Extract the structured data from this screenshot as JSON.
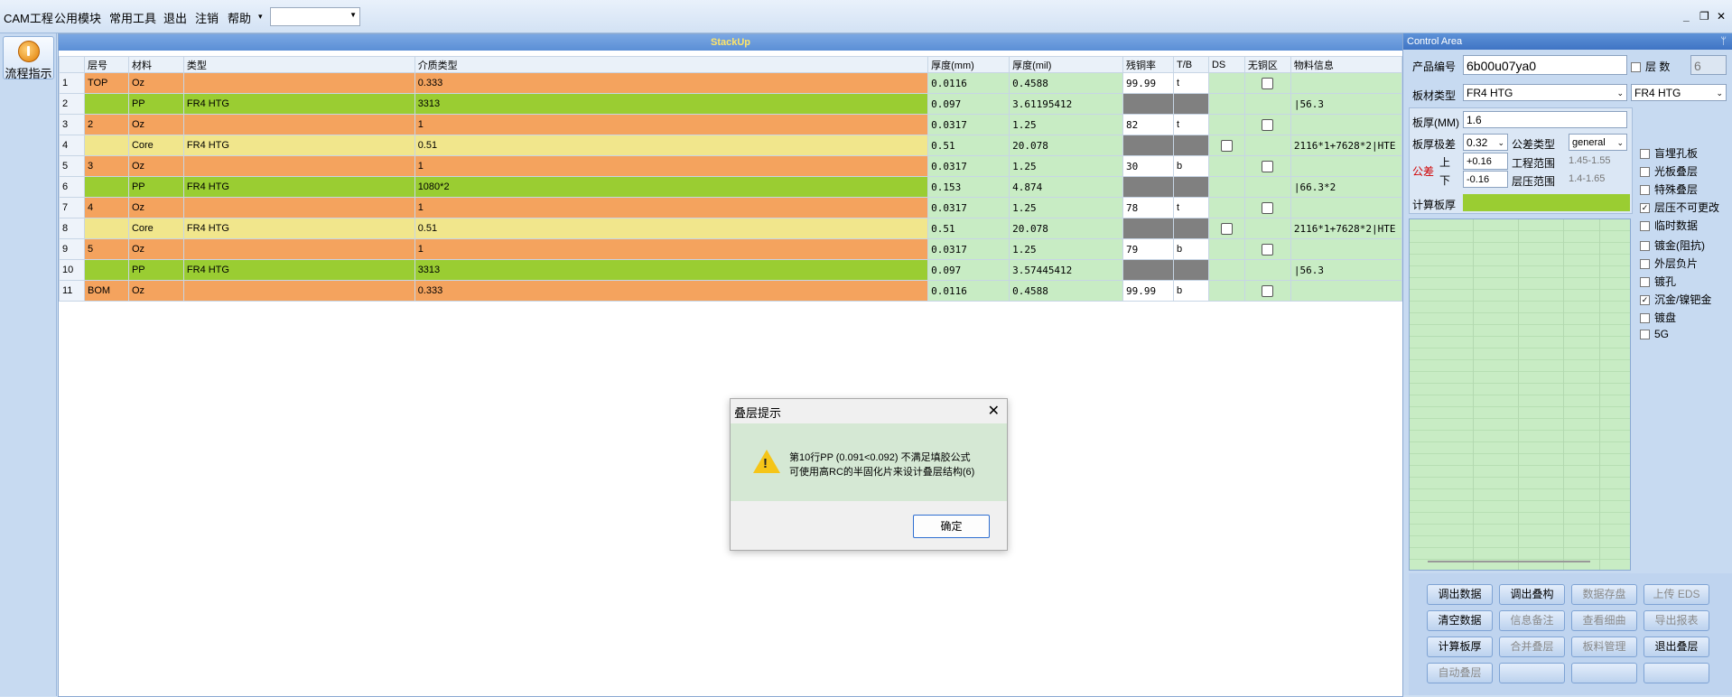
{
  "menu": {
    "items": [
      "CAM工程",
      "公用模块",
      "常用工具",
      "退出",
      "注销",
      "帮助"
    ],
    "dropdown_arrow": "▾"
  },
  "window_controls": {
    "minimize": "_",
    "restore": "❐",
    "close": "✕"
  },
  "left": {
    "flow_button": "流程指示"
  },
  "stackup": {
    "title": "StackUp",
    "headers": [
      "层号",
      "材料",
      "类型",
      "介质类型",
      "厚度(mm)",
      "厚度(mil)",
      "残铜率",
      "T/B",
      "DS",
      "无铜区",
      "物料信息"
    ],
    "rows": [
      {
        "n": "1",
        "layer": "TOP",
        "mat": "Oz",
        "type": "",
        "med": "0.333",
        "mm": "0.0116",
        "mil": "0.4588",
        "cu": "99.99",
        "tb": "t",
        "ds": "",
        "nocu": true,
        "info": ""
      },
      {
        "n": "2",
        "layer": "",
        "mat": "PP",
        "type": "FR4 HTG",
        "med": "3313",
        "mm": "0.097",
        "mil": "3.61195412",
        "cu": "",
        "tb": "",
        "ds": "",
        "nocu": false,
        "info": "|56.3"
      },
      {
        "n": "3",
        "layer": "2",
        "mat": "Oz",
        "type": "",
        "med": "1",
        "mm": "0.0317",
        "mil": "1.25",
        "cu": "82",
        "tb": "t",
        "ds": "",
        "nocu": true,
        "info": ""
      },
      {
        "n": "4",
        "layer": "",
        "mat": "Core",
        "type": "FR4 HTG",
        "med": "0.51",
        "mm": "0.51",
        "mil": "20.078",
        "cu": "",
        "tb": "",
        "ds": "cb",
        "nocu": false,
        "info": "2116*1+7628*2|HTE"
      },
      {
        "n": "5",
        "layer": "3",
        "mat": "Oz",
        "type": "",
        "med": "1",
        "mm": "0.0317",
        "mil": "1.25",
        "cu": "30",
        "tb": "b",
        "ds": "",
        "nocu": true,
        "info": ""
      },
      {
        "n": "6",
        "layer": "",
        "mat": "PP",
        "type": "FR4 HTG",
        "med": "1080*2",
        "mm": "0.153",
        "mil": "4.874",
        "cu": "",
        "tb": "",
        "ds": "",
        "nocu": false,
        "info": "|66.3*2"
      },
      {
        "n": "7",
        "layer": "4",
        "mat": "Oz",
        "type": "",
        "med": "1",
        "mm": "0.0317",
        "mil": "1.25",
        "cu": "78",
        "tb": "t",
        "ds": "",
        "nocu": true,
        "info": ""
      },
      {
        "n": "8",
        "layer": "",
        "mat": "Core",
        "type": "FR4 HTG",
        "med": "0.51",
        "mm": "0.51",
        "mil": "20.078",
        "cu": "",
        "tb": "",
        "ds": "cb",
        "nocu": false,
        "info": "2116*1+7628*2|HTE"
      },
      {
        "n": "9",
        "layer": "5",
        "mat": "Oz",
        "type": "",
        "med": "1",
        "mm": "0.0317",
        "mil": "1.25",
        "cu": "79",
        "tb": "b",
        "ds": "",
        "nocu": true,
        "info": ""
      },
      {
        "n": "10",
        "layer": "",
        "mat": "PP",
        "type": "FR4 HTG",
        "med": "3313",
        "mm": "0.097",
        "mil": "3.57445412",
        "cu": "",
        "tb": "",
        "ds": "",
        "nocu": false,
        "info": "|56.3"
      },
      {
        "n": "11",
        "layer": "BOM",
        "mat": "Oz",
        "type": "",
        "med": "0.333",
        "mm": "0.0116",
        "mil": "0.4588",
        "cu": "99.99",
        "tb": "b",
        "ds": "",
        "nocu": true,
        "info": ""
      }
    ]
  },
  "dialog": {
    "title": "叠层提示",
    "close": "✕",
    "line1": "第10行PP (0.091<0.092) 不满足填胶公式",
    "line2": "可使用高RC的半固化片来设计叠层结构(6)",
    "ok": "确定"
  },
  "control": {
    "title": "Control Area",
    "pin": "ᛘ",
    "product_label": "产品编号",
    "product_value": "6b00u07ya0",
    "layers_label": "层  数",
    "layers_value": "6",
    "board_type_label": "板材类型",
    "board_type_value": "FR4 HTG",
    "board_type_value2": "FR4 HTG",
    "thickness_label": "板厚(MM)",
    "thickness_value": "1.6",
    "tol_label": "板厚极差",
    "tol_value": "0.32",
    "tol_type_label": "公差类型",
    "tol_type_value": "general",
    "tol_side_label": "公差",
    "upper_label": "上",
    "upper_value": "+0.16",
    "lower_label": "下",
    "lower_value": "-0.16",
    "eng_range_label": "工程范围",
    "eng_range_value": "1.45-1.55",
    "press_range_label": "层压范围",
    "press_range_value": "1.4-1.65",
    "calc_label": "计算板厚",
    "checks": [
      {
        "label": "盲埋孔板",
        "checked": false
      },
      {
        "label": "光板叠层",
        "checked": false
      },
      {
        "label": "特殊叠层",
        "checked": false
      },
      {
        "label": "层压不可更改",
        "checked": true
      },
      {
        "label": "临时数据",
        "checked": false
      },
      {
        "label": "镀金(阻抗)",
        "checked": false
      },
      {
        "label": "外层负片",
        "checked": false
      },
      {
        "label": "镀孔",
        "checked": false
      },
      {
        "label": "沉金/镍钯金",
        "checked": true
      },
      {
        "label": "镀盘",
        "checked": false
      },
      {
        "label": "5G",
        "checked": false
      }
    ],
    "buttons": [
      [
        "调出数据",
        "调出叠构",
        "数据存盘",
        "上传 EDS"
      ],
      [
        "清空数据",
        "信息备注",
        "查看细曲",
        "导出报表"
      ],
      [
        "计算板厚",
        "合并叠层",
        "板料管理",
        "退出叠层"
      ],
      [
        "自动叠层",
        "",
        "",
        ""
      ]
    ]
  }
}
